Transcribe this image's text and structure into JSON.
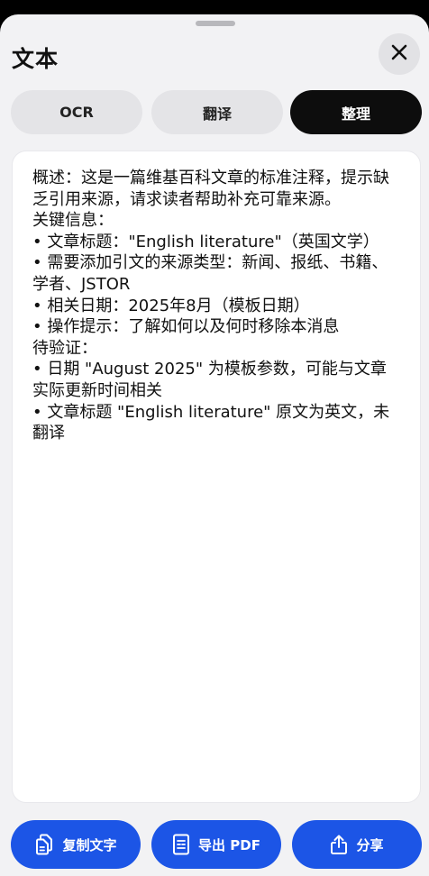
{
  "header": {
    "title": "文本"
  },
  "tabs": [
    {
      "label": "OCR",
      "active": false
    },
    {
      "label": "翻译",
      "active": false
    },
    {
      "label": "整理",
      "active": true
    }
  ],
  "content": {
    "text": "概述：这是一篇维基百科文章的标准注释，提示缺乏引用来源，请求读者帮助补充可靠来源。\n关键信息：\n• 文章标题：\"English literature\"（英国文学）\n• 需要添加引文的来源类型：新闻、报纸、书籍、学者、JSTOR\n• 相关日期：2025年8月（模板日期）\n• 操作提示：了解如何以及何时移除本消息\n待验证：\n• 日期 \"August 2025\" 为模板参数，可能与文章实际更新时间相关\n• 文章标题 \"English literature\" 原文为英文，未翻译"
  },
  "actions": {
    "copy_label": "复制文字",
    "export_label": "导出 PDF",
    "share_label": "分享"
  },
  "colors": {
    "accent": "#1c55e6",
    "active_tab": "#0d0d0d",
    "sheet_bg": "#f2f2f4"
  },
  "icons": {
    "close": "close-icon",
    "copy": "copy-icon",
    "export": "pdf-icon",
    "share": "share-icon"
  }
}
